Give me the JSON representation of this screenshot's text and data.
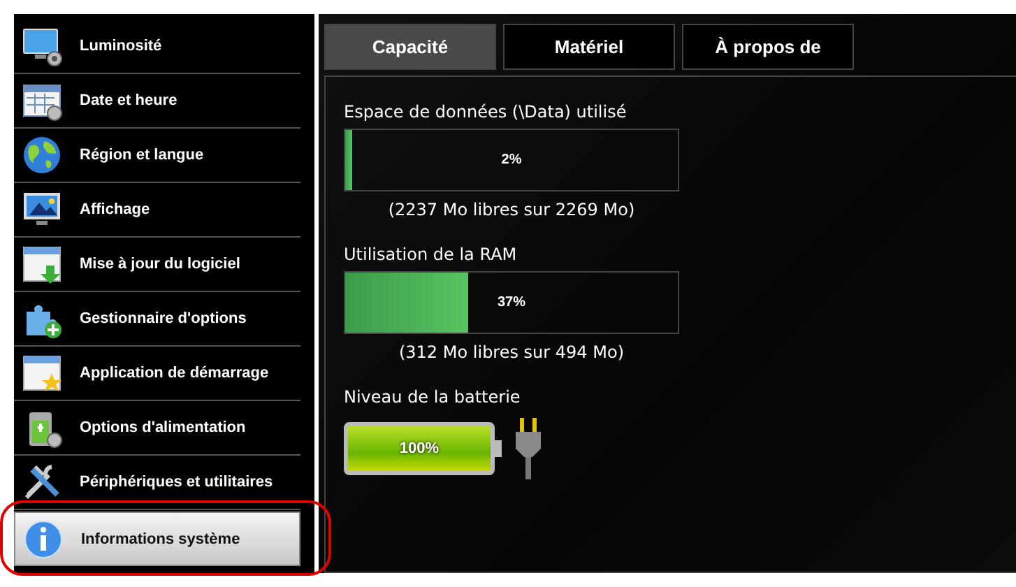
{
  "sidebar": {
    "items": [
      {
        "label": "Luminosité",
        "selected": false,
        "highlighted": false
      },
      {
        "label": "Date et heure",
        "selected": false,
        "highlighted": false
      },
      {
        "label": "Région et langue",
        "selected": false,
        "highlighted": false
      },
      {
        "label": "Affichage",
        "selected": false,
        "highlighted": false
      },
      {
        "label": "Mise à jour du logiciel",
        "selected": false,
        "highlighted": false
      },
      {
        "label": "Gestionnaire d'options",
        "selected": false,
        "highlighted": false
      },
      {
        "label": "Application de démarrage",
        "selected": false,
        "highlighted": false
      },
      {
        "label": "Options d'alimentation",
        "selected": false,
        "highlighted": false
      },
      {
        "label": "Périphériques et utilitaires",
        "selected": false,
        "highlighted": false
      },
      {
        "label": "Informations système",
        "selected": true,
        "highlighted": true
      }
    ]
  },
  "tabs": [
    {
      "label": "Capacité",
      "selected": true
    },
    {
      "label": "Matériel",
      "selected": false
    },
    {
      "label": "À propos de",
      "selected": false
    }
  ],
  "sections": [
    {
      "kind": "bar",
      "title": "Espace de données (\\Data) utilisé",
      "level": 0.02,
      "reading": "2%",
      "detail": "(2237 Mo libres sur 2269 Mo)"
    },
    {
      "kind": "bar",
      "title": "Utilisation de la RAM",
      "level": 0.37,
      "reading": "37%",
      "detail": "(312 Mo libres sur 494 Mo)"
    },
    {
      "kind": "battery",
      "title": "Niveau de la batterie",
      "level": 1,
      "reading": "100%",
      "plugged": true
    }
  ]
}
